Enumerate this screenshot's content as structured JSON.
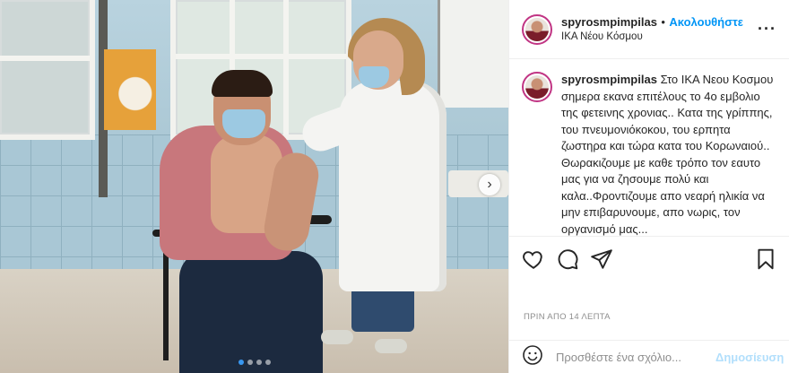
{
  "header": {
    "username": "spyrosmpimpilas",
    "separator": "•",
    "follow_label": "Ακολουθήστε",
    "location": "ΙΚΑ Νέου Κόσμου",
    "more_label": "···"
  },
  "caption": {
    "username": "spyrosmpimpilas",
    "text": "Στο ΙΚΑ Νεου Κοσμου σημερα εκανα επιτέλους το 4ο εμβολιο της φετεινης χρονιας.. Κατα της γρίππης, του πνευμονιόκοκου, του ερπητα ζωστηρα και τώρα κατα του Κορωναιού.. Θωρακιζουμε με καθε τρόπο τον εαυτο μας για να ζησουμε πολύ και καλα..Φροντιζουμε απο νεαρή ηλικία να μην επιβαρυνουμε, απο νωρις, τον οργανισμό μας..."
  },
  "icons": {
    "like": "heart-icon",
    "comment": "speech-bubble-icon",
    "share": "paper-plane-icon",
    "save": "bookmark-icon",
    "next": "chevron-right-icon",
    "emoji": "smiley-icon"
  },
  "carousel": {
    "total": 4,
    "current": 1
  },
  "timestamp": "ΠΡΙΝ ΑΠΟ 14 ΛΕΠΤΑ",
  "comment_box": {
    "placeholder": "Προσθέστε ένα σχόλιο...",
    "post_label": "Δημοσίευση"
  },
  "colors": {
    "accent": "#0095f6",
    "post_disabled": "#b2dffc",
    "muted": "#8e8e8e"
  }
}
